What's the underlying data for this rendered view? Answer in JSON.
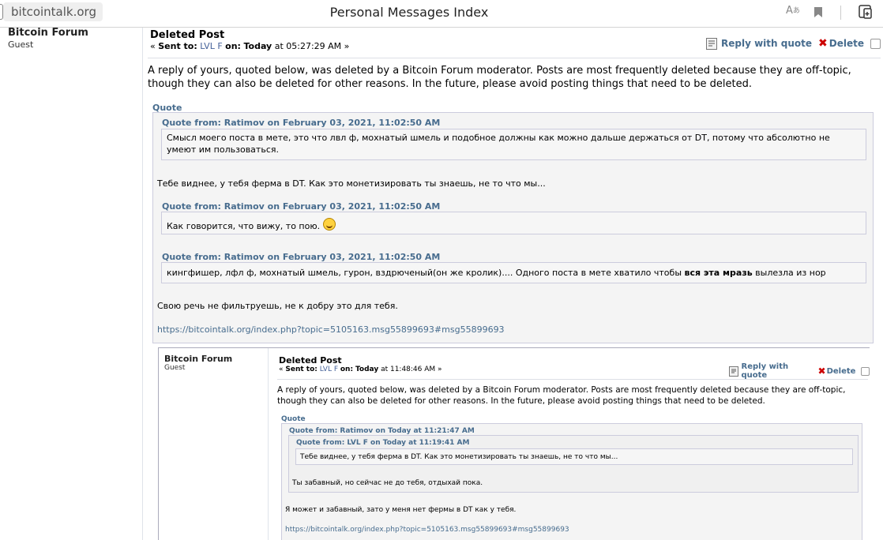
{
  "browser": {
    "url": "bitcointalk.org",
    "title": "Personal Messages Index",
    "icons": [
      "read-aloud-icon",
      "bookmark-icon",
      "collections-icon"
    ]
  },
  "sender": {
    "name": "Bitcoin Forum",
    "group": "Guest"
  },
  "message": {
    "title": "Deleted Post",
    "sent_prefix": "« ",
    "sent_to_label": "Sent to:",
    "sent_to_user": "LVL F",
    "on_label": "on:",
    "date_bold": "Today",
    "time": "at 05:27:29 AM »",
    "reply_label": "Reply with quote",
    "delete_label": "Delete",
    "body": "A reply of yours, quoted below, was deleted by a Bitcoin Forum moderator. Posts are most frequently deleted because they are off-topic, though they can also be deleted for other reasons. In the future, please avoid posting things that need to be deleted.",
    "quote_label": "Quote",
    "quote1_head": "Quote from: Ratimov on February 03, 2021, 11:02:50 AM",
    "quote1_text": "Смысл моего поста в мете, это что лвл ф, мохнатый шмель и подобное должны как можно дальше держаться от DT, потому что абсолютно не умеют им пользоваться.",
    "reply1": "Тебе виднее, у тебя ферма в DT. Как это монетизировать ты знаешь, не то что мы...",
    "quote2_head": "Quote from: Ratimov on February 03, 2021, 11:02:50 AM",
    "quote2_text": "Как говорится, что вижу, то пою.",
    "quote3_head": "Quote from: Ratimov on February 03, 2021, 11:02:50 AM",
    "quote3_text_a": "кингфишер, лфл ф, мохнатый шмель, гурон, вздрюченый(он же кролик).... Одного поста в мете хватило чтобы ",
    "quote3_bold": "вся эта мразь",
    "quote3_text_b": " вылезла из нор",
    "reply2": "Свою речь не фильтруешь, не к добру это для тебя.",
    "link": "https://bitcointalk.org/index.php?topic=5105163.msg55899693#msg55899693"
  },
  "nested": {
    "sender_name": "Bitcoin Forum",
    "sender_group": "Guest",
    "title": "Deleted Post",
    "sent_prefix": "« ",
    "sent_to_label": "Sent to:",
    "sent_to_user": "LVL F",
    "on_label": "on:",
    "date_bold": "Today",
    "time": "at 11:48:46 AM »",
    "reply_label": "Reply with quote",
    "delete_label": "Delete",
    "body": "A reply of yours, quoted below, was deleted by a Bitcoin Forum moderator. Posts are most frequently deleted because they are off-topic, though they can also be deleted for other reasons. In the future, please avoid posting things that need to be deleted.",
    "quote_label": "Quote",
    "quote_head": "Quote from: Ratimov on Today at 11:21:47 AM",
    "inner_quote_head": "Quote from: LVL F on Today at 11:19:41 AM",
    "inner_quote_text": "Тебе виднее, у тебя ферма в DT. Как это монетизировать ты знаешь, не то что мы...",
    "quote_text": "Ты забавный, но сейчас не до тебя, отдыхай пока.",
    "reply": "Я может и забавный, зато у меня нет фермы в DT как у тебя.",
    "link": "https://bitcointalk.org/index.php?topic=5105163.msg55899693#msg55899693"
  }
}
